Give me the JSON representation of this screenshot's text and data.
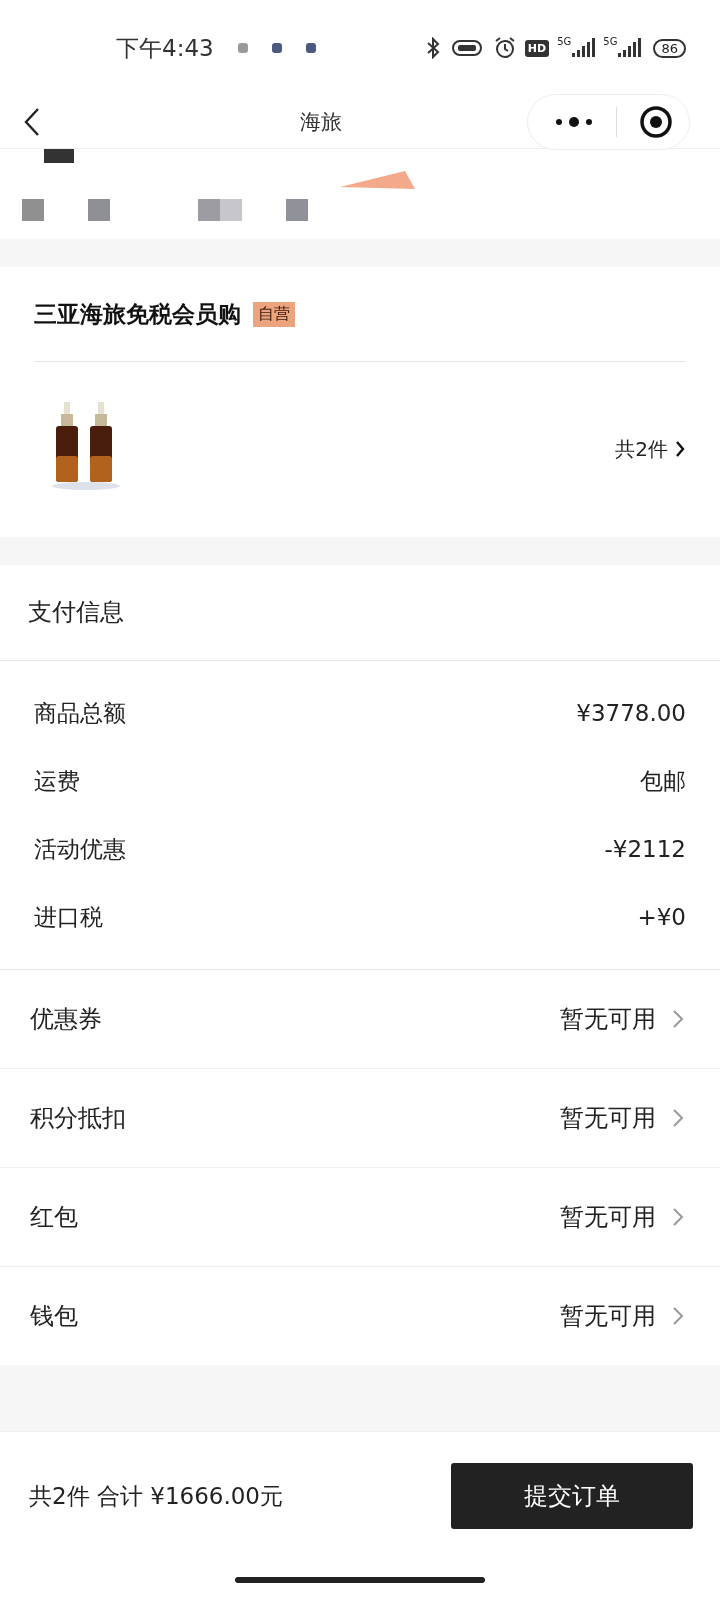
{
  "status_bar": {
    "time": "下午4:43",
    "hd": "HD",
    "networks": [
      "5G",
      "5G"
    ],
    "battery": "86"
  },
  "nav": {
    "title": "海旅"
  },
  "store": {
    "name": "三亚海旅免税会员购",
    "tag": "自营",
    "count": "共2件"
  },
  "payment": {
    "title": "支付信息",
    "lines": [
      {
        "label": "商品总额",
        "value": "¥3778.00"
      },
      {
        "label": "运费",
        "value": "包邮"
      },
      {
        "label": "活动优惠",
        "value": "-¥2112"
      },
      {
        "label": "进口税",
        "value": "+¥0"
      }
    ],
    "options": [
      {
        "label": "优惠券",
        "value": "暂无可用"
      },
      {
        "label": "积分抵扣",
        "value": "暂无可用"
      },
      {
        "label": "红包",
        "value": "暂无可用"
      },
      {
        "label": "钱包",
        "value": "暂无可用"
      }
    ]
  },
  "footer": {
    "summary": "共2件 合计 ¥1666.00元",
    "submit": "提交订单"
  }
}
